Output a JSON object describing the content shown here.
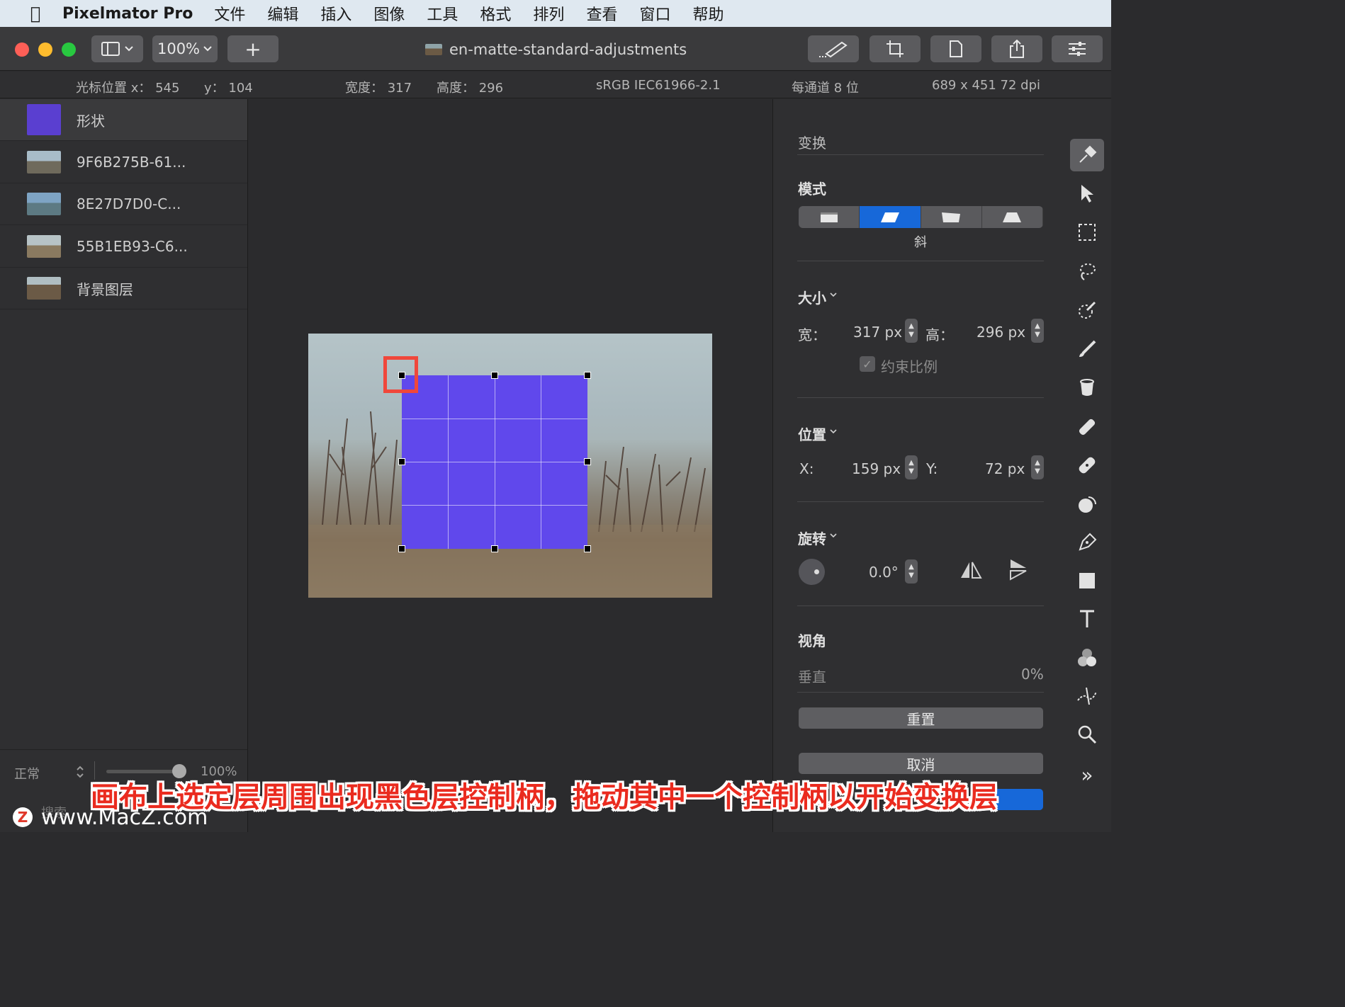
{
  "menubar": {
    "app_name": "Pixelmator Pro",
    "items": [
      "文件",
      "编辑",
      "插入",
      "图像",
      "工具",
      "格式",
      "排列",
      "查看",
      "窗口",
      "帮助"
    ]
  },
  "toolbar": {
    "zoom": "100%",
    "add_label": "+",
    "document_title": "en-matte-standard-adjustments"
  },
  "infobar": {
    "cursor_x": "光标位置 x： 545",
    "cursor_y": "y： 104",
    "width": "宽度： 317",
    "height": "高度： 296",
    "color_profile": "sRGB IEC61966-2.1",
    "bit_depth": "每通道 8 位",
    "dimensions": "689 x 451 72 dpi"
  },
  "layers": [
    {
      "name": "形状",
      "selected": true
    },
    {
      "name": "9F6B275B-61...",
      "selected": false
    },
    {
      "name": "8E27D7D0-C...",
      "selected": false
    },
    {
      "name": "55B1EB93-C6...",
      "selected": false
    },
    {
      "name": "背景图层",
      "selected": false
    }
  ],
  "layers_footer": {
    "blend_mode": "正常",
    "opacity": "100%",
    "search_placeholder": "搜索"
  },
  "inspector": {
    "section_title": "变换",
    "mode_label": "模式",
    "mode_selected_name": "斜",
    "size_label": "大小",
    "width_label": "宽：",
    "width_value": "317 px",
    "height_label": "高：",
    "height_value": "296 px",
    "constrain_label": "约束比例",
    "position_label": "位置",
    "x_label": "X:",
    "x_value": "159 px",
    "y_label": "Y:",
    "y_value": "72 px",
    "rotation_label": "旋转",
    "rotation_value": "0.0°",
    "perspective_label": "视角",
    "vertical_label": "垂直",
    "vertical_value": "0%",
    "reset_label": "重置",
    "cancel_label": "取消"
  },
  "tools_more": "»",
  "caption": "画布上选定层周围出现黑色层控制柄，拖动其中一个控制柄以开始变换层",
  "watermark": "www.MacZ.com",
  "watermark_logo": "Z",
  "colors": {
    "shape_fill": "#6048ec",
    "accent": "#1768d9",
    "highlight": "#f0473b",
    "caption": "#ea2b1f"
  }
}
